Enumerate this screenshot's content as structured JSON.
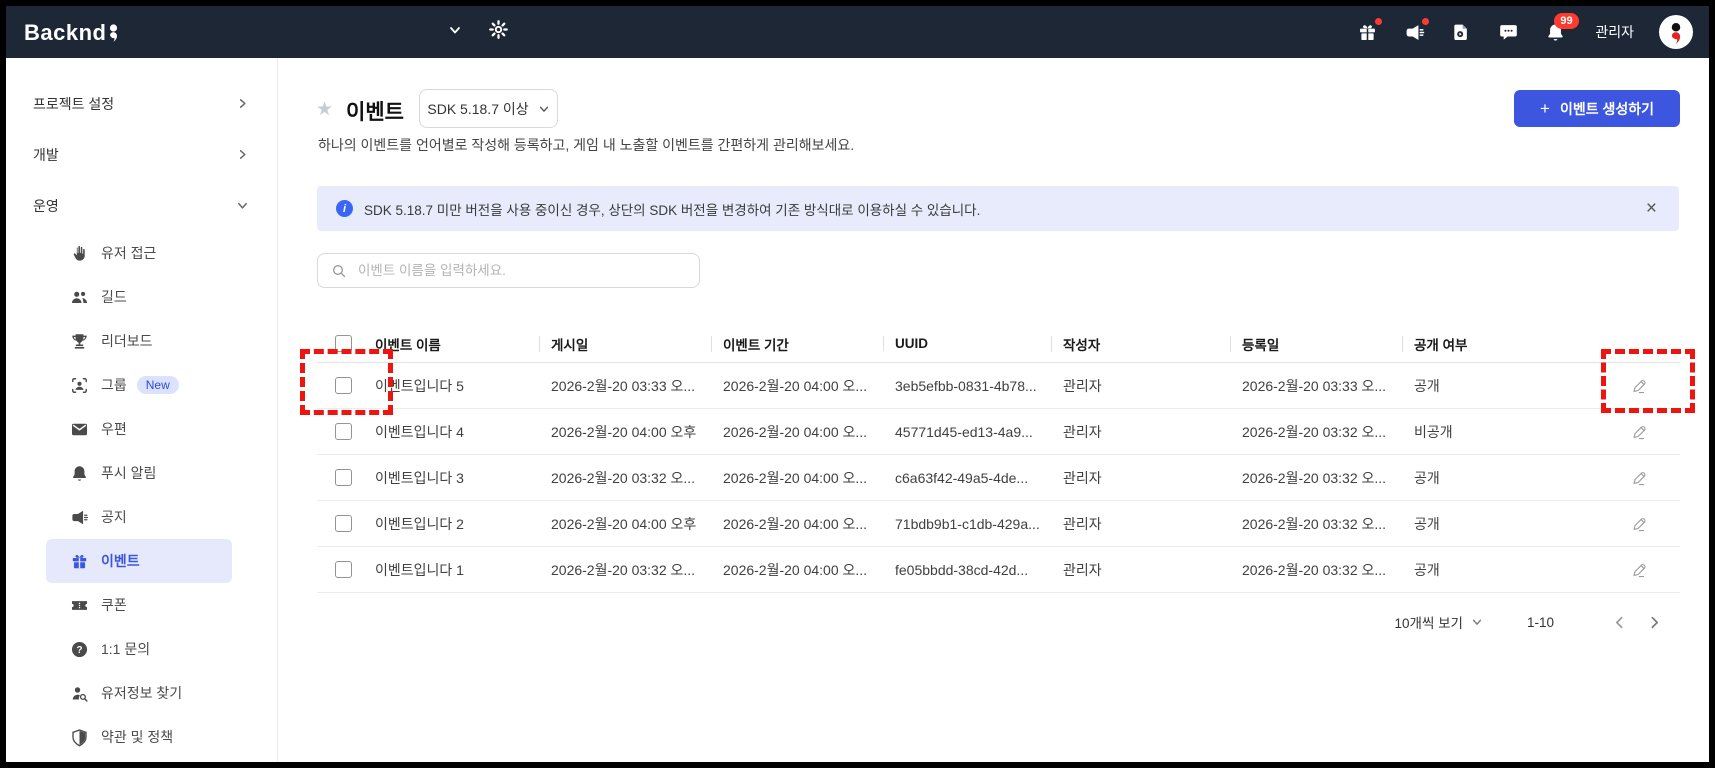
{
  "topbar": {
    "logo": "Backnd",
    "notification_count": "99",
    "user_label": "관리자"
  },
  "sidebar": {
    "sections": [
      {
        "label": "프로젝트 설정",
        "state": "collapsed"
      },
      {
        "label": "개발",
        "state": "collapsed"
      },
      {
        "label": "운영",
        "state": "expanded"
      }
    ],
    "items": [
      {
        "label": "유저 접근",
        "icon": "hand-icon"
      },
      {
        "label": "길드",
        "icon": "people-icon"
      },
      {
        "label": "리더보드",
        "icon": "trophy-icon"
      },
      {
        "label": "그룹",
        "icon": "group-icon",
        "badge": "New"
      },
      {
        "label": "우편",
        "icon": "mail-icon"
      },
      {
        "label": "푸시 알림",
        "icon": "bell-icon"
      },
      {
        "label": "공지",
        "icon": "megaphone-icon"
      },
      {
        "label": "이벤트",
        "icon": "gift-icon",
        "selected": true
      },
      {
        "label": "쿠폰",
        "icon": "coupon-icon"
      },
      {
        "label": "1:1 문의",
        "icon": "question-icon"
      },
      {
        "label": "유저정보 찾기",
        "icon": "user-search-icon"
      },
      {
        "label": "약관 및 정책",
        "icon": "shield-icon"
      }
    ]
  },
  "page": {
    "title": "이벤트",
    "sdk_selector": "SDK 5.18.7 이상",
    "create_plus": "+",
    "create_button": "이벤트 생성하기",
    "description": "하나의 이벤트를 언어별로 작성해 등록하고, 게임 내 노출할 이벤트를 간편하게 관리해보세요.",
    "banner_text": "SDK 5.18.7 미만 버전을 사용 중이신 경우, 상단의 SDK 버전을 변경하여 기존 방식대로 이용하실 수 있습니다.",
    "banner_info_glyph": "i",
    "banner_close_glyph": "×",
    "search_placeholder": "이벤트 이름을 입력하세요."
  },
  "table": {
    "columns": [
      "이벤트 이름",
      "게시일",
      "이벤트 기간",
      "UUID",
      "작성자",
      "등록일",
      "공개 여부"
    ],
    "rows": [
      {
        "name": "이벤트입니다 5",
        "published": "2026-2월-20 03:33 오...",
        "period": "2026-2월-20 04:00 오...",
        "uuid": "3eb5efbb-0831-4b78...",
        "author": "관리자",
        "registered": "2026-2월-20 03:33 오...",
        "visibility": "공개"
      },
      {
        "name": "이벤트입니다 4",
        "published": "2026-2월-20 04:00 오후",
        "period": "2026-2월-20 04:00 오...",
        "uuid": "45771d45-ed13-4a9...",
        "author": "관리자",
        "registered": "2026-2월-20 03:32 오...",
        "visibility": "비공개"
      },
      {
        "name": "이벤트입니다 3",
        "published": "2026-2월-20 03:32 오...",
        "period": "2026-2월-20 04:00 오...",
        "uuid": "c6a63f42-49a5-4de...",
        "author": "관리자",
        "registered": "2026-2월-20 03:32 오...",
        "visibility": "공개"
      },
      {
        "name": "이벤트입니다 2",
        "published": "2026-2월-20 04:00 오후",
        "period": "2026-2월-20 04:00 오...",
        "uuid": "71bdb9b1-c1db-429a...",
        "author": "관리자",
        "registered": "2026-2월-20 03:32 오...",
        "visibility": "공개"
      },
      {
        "name": "이벤트입니다 1",
        "published": "2026-2월-20 03:32 오...",
        "period": "2026-2월-20 04:00 오...",
        "uuid": "fe05bbdd-38cd-42d...",
        "author": "관리자",
        "registered": "2026-2월-20 03:32 오...",
        "visibility": "공개"
      }
    ]
  },
  "pagination": {
    "page_size_label": "10개씩 보기",
    "range": "1-10"
  },
  "colors": {
    "topbar_bg": "#1d2736",
    "accent_blue": "#3d56e0",
    "selected_item_bg": "#e5e9fb",
    "banner_bg": "#e7ebfb",
    "badge_red": "#ff3b30",
    "annotation_red": "#ee1511"
  }
}
